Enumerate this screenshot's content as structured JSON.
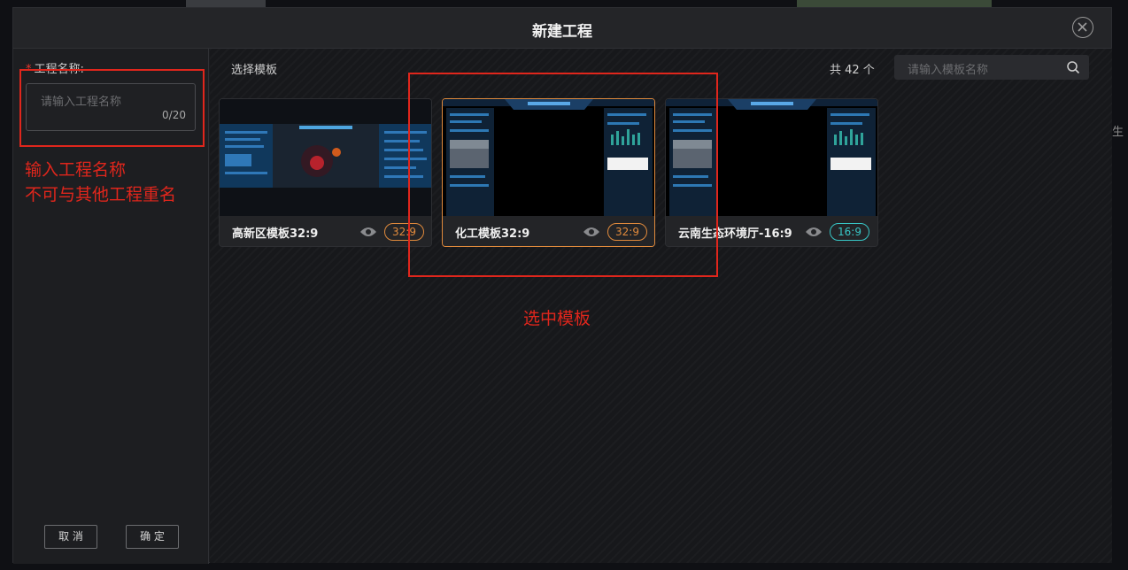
{
  "background": {
    "side_text": "生"
  },
  "modal": {
    "title": "新建工程",
    "close_icon": "close-circle-icon"
  },
  "form": {
    "required_mark": "*",
    "name_label": "工程名称:",
    "name_placeholder": "请输入工程名称",
    "name_count": "0/20",
    "cancel_label": "取 消",
    "confirm_label": "确 定"
  },
  "templates": {
    "section_label": "选择模板",
    "total_text": "共 42 个",
    "search_placeholder": "请输入模板名称",
    "search_icon": "search-icon",
    "items": [
      {
        "name": "高新区模板32:9",
        "ratio": "32:9",
        "ratio_color": "#e08a3c",
        "preview_icon": "eye-icon",
        "selected": false
      },
      {
        "name": "化工模板32:9",
        "ratio": "32:9",
        "ratio_color": "#e08a3c",
        "preview_icon": "eye-icon",
        "selected": true
      },
      {
        "name": "云南生态环境厅-16:9",
        "ratio": "16:9",
        "ratio_color": "#38c7c7",
        "preview_icon": "eye-icon",
        "selected": false
      }
    ]
  },
  "annotations": {
    "name_hint_line1": "输入工程名称",
    "name_hint_line2": "不可与其他工程重名",
    "select_hint": "选中模板",
    "color": "#e0261c"
  }
}
